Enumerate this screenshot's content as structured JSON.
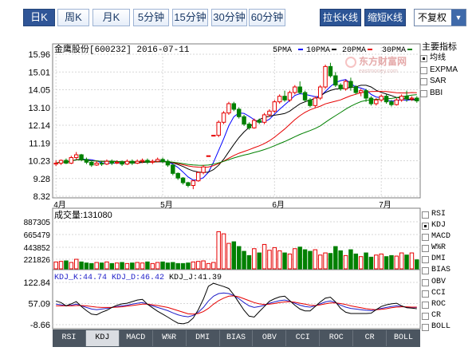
{
  "period_tabs": [
    {
      "label": "日K",
      "active": true
    },
    {
      "label": "周K",
      "active": false
    },
    {
      "label": "月K",
      "active": false
    },
    {
      "label": "5分钟",
      "active": false
    },
    {
      "label": "15分钟",
      "active": false
    },
    {
      "label": "30分钟",
      "active": false
    },
    {
      "label": "60分钟",
      "active": false
    }
  ],
  "controls": {
    "stretch": "拉长K线",
    "shrink": "缩短K线",
    "adjust": "不复权"
  },
  "main": {
    "title": "金鹰股份[600232] 2016-07-11",
    "ma_legend": [
      {
        "label": "5PMA",
        "color": "#0000ff"
      },
      {
        "label": "10PMA",
        "color": "#000000"
      },
      {
        "label": "20PMA",
        "color": "#e60000"
      },
      {
        "label": "30PMA",
        "color": "#008000"
      }
    ],
    "watermark": "东方财富网",
    "watermark_sub": "eastmoney.com"
  },
  "indicators": {
    "title": "主要指标",
    "items": [
      {
        "label": "均线",
        "checked": true
      },
      {
        "label": "EXPMA",
        "checked": false
      },
      {
        "label": "SAR",
        "checked": false
      },
      {
        "label": "BBI",
        "checked": false
      }
    ]
  },
  "volume": {
    "label": "成交量:131080"
  },
  "kdj": {
    "k": "KDJ_K:44.74",
    "d": "KDJ_D:46.42",
    "j": "KDJ_J:41.39"
  },
  "sub_indicators": [
    {
      "label": "RSI",
      "checked": false
    },
    {
      "label": "KDJ",
      "checked": true
    },
    {
      "label": "MACD",
      "checked": false
    },
    {
      "label": "W%R",
      "checked": false
    },
    {
      "label": "DMI",
      "checked": false
    },
    {
      "label": "BIAS",
      "checked": false
    },
    {
      "label": "OBV",
      "checked": false
    },
    {
      "label": "CCI",
      "checked": false
    },
    {
      "label": "ROC",
      "checked": false
    },
    {
      "label": "CR",
      "checked": false
    },
    {
      "label": "BOLL",
      "checked": false
    }
  ],
  "bottom_tabs": [
    {
      "label": "RSI",
      "active": false
    },
    {
      "label": "KDJ",
      "active": true
    },
    {
      "label": "MACD",
      "active": false
    },
    {
      "label": "W%R",
      "active": false
    },
    {
      "label": "DMI",
      "active": false
    },
    {
      "label": "BIAS",
      "active": false
    },
    {
      "label": "OBV",
      "active": false
    },
    {
      "label": "CCI",
      "active": false
    },
    {
      "label": "ROC",
      "active": false
    },
    {
      "label": "CR",
      "active": false
    },
    {
      "label": "BOLL",
      "active": false
    }
  ],
  "chart_data": [
    {
      "type": "candlestick",
      "title": "金鹰股份[600232] 2016-07-11",
      "y_ticks": [
        "15.96",
        "15.01",
        "14.05",
        "13.10",
        "12.14",
        "11.19",
        "10.23",
        "9.28",
        "8.32"
      ],
      "ylim": [
        8.32,
        15.96
      ],
      "x_ticks": [
        "4月",
        "5月",
        "6月",
        "7月"
      ],
      "candles": [
        [
          10.05,
          10.1,
          9.95,
          10.25
        ],
        [
          10.1,
          10.25,
          10.0,
          10.3
        ],
        [
          10.25,
          10.1,
          10.05,
          10.35
        ],
        [
          10.1,
          10.4,
          10.05,
          10.5
        ],
        [
          10.4,
          10.55,
          10.3,
          10.7
        ],
        [
          10.55,
          10.3,
          10.2,
          10.6
        ],
        [
          10.3,
          10.15,
          10.05,
          10.4
        ],
        [
          10.15,
          10.0,
          9.9,
          10.25
        ],
        [
          10.0,
          10.1,
          9.95,
          10.2
        ],
        [
          10.1,
          10.05,
          9.95,
          10.2
        ],
        [
          10.05,
          10.2,
          10.0,
          10.3
        ],
        [
          10.2,
          10.1,
          10.0,
          10.3
        ],
        [
          10.1,
          10.15,
          10.05,
          10.25
        ],
        [
          10.15,
          10.05,
          9.95,
          10.25
        ],
        [
          10.05,
          10.2,
          10.0,
          10.3
        ],
        [
          10.2,
          10.1,
          10.0,
          10.3
        ],
        [
          10.1,
          10.2,
          10.05,
          10.3
        ],
        [
          10.2,
          10.25,
          10.1,
          10.35
        ],
        [
          10.25,
          10.15,
          10.05,
          10.35
        ],
        [
          10.15,
          10.2,
          10.05,
          10.3
        ],
        [
          10.2,
          10.3,
          10.15,
          10.4
        ],
        [
          10.3,
          10.2,
          10.1,
          10.4
        ],
        [
          10.2,
          10.0,
          9.9,
          10.3
        ],
        [
          10.0,
          9.55,
          9.45,
          10.05
        ],
        [
          9.55,
          9.3,
          9.2,
          9.6
        ],
        [
          9.3,
          9.05,
          8.95,
          9.35
        ],
        [
          9.05,
          8.9,
          8.8,
          9.1
        ],
        [
          8.9,
          9.15,
          8.7,
          9.2
        ],
        [
          9.15,
          9.6,
          9.1,
          9.65
        ],
        [
          9.6,
          9.9,
          9.5,
          10.0
        ],
        [
          10.5,
          10.5,
          10.5,
          10.5
        ],
        [
          11.6,
          11.6,
          11.6,
          11.6
        ],
        [
          11.6,
          12.3,
          11.5,
          12.4
        ],
        [
          12.3,
          12.8,
          12.2,
          12.9
        ],
        [
          12.8,
          13.3,
          12.7,
          13.4
        ],
        [
          13.3,
          13.0,
          12.9,
          13.4
        ],
        [
          13.0,
          12.6,
          12.5,
          13.1
        ],
        [
          12.6,
          12.2,
          12.1,
          12.7
        ],
        [
          12.2,
          12.0,
          11.9,
          12.3
        ],
        [
          12.0,
          12.4,
          11.95,
          12.5
        ],
        [
          12.4,
          12.3,
          12.2,
          12.5
        ],
        [
          12.3,
          12.7,
          12.2,
          12.8
        ],
        [
          12.7,
          12.9,
          12.6,
          13.0
        ],
        [
          12.9,
          13.4,
          12.8,
          13.5
        ],
        [
          13.4,
          13.7,
          13.3,
          13.8
        ],
        [
          13.7,
          13.5,
          13.4,
          14.0
        ],
        [
          13.5,
          13.9,
          13.4,
          14.0
        ],
        [
          13.9,
          14.2,
          13.8,
          14.3
        ],
        [
          14.2,
          13.9,
          13.8,
          14.5
        ],
        [
          13.9,
          13.5,
          13.4,
          14.0
        ],
        [
          13.5,
          13.2,
          13.1,
          13.6
        ],
        [
          13.2,
          13.6,
          13.1,
          13.7
        ],
        [
          13.6,
          14.2,
          13.5,
          14.3
        ],
        [
          14.2,
          15.3,
          14.1,
          15.4
        ],
        [
          15.3,
          14.8,
          14.7,
          15.5
        ],
        [
          14.8,
          14.3,
          14.2,
          15.0
        ],
        [
          14.3,
          14.1,
          14.0,
          14.4
        ],
        [
          14.1,
          14.5,
          14.0,
          14.6
        ],
        [
          14.5,
          14.2,
          14.0,
          14.7
        ],
        [
          14.2,
          13.9,
          13.8,
          14.3
        ],
        [
          13.9,
          14.0,
          13.7,
          14.1
        ],
        [
          14.0,
          13.6,
          13.4,
          14.1
        ],
        [
          13.6,
          13.3,
          13.2,
          13.7
        ],
        [
          13.3,
          13.5,
          13.2,
          13.6
        ],
        [
          13.5,
          13.7,
          13.4,
          13.8
        ],
        [
          13.7,
          13.4,
          13.3,
          13.8
        ],
        [
          13.4,
          13.25,
          13.15,
          13.5
        ],
        [
          13.25,
          13.5,
          13.2,
          13.6
        ],
        [
          13.5,
          13.7,
          13.4,
          13.8
        ],
        [
          13.7,
          13.55,
          13.4,
          14.0
        ],
        [
          13.55,
          13.6,
          13.45,
          13.7
        ],
        [
          13.6,
          13.45,
          13.35,
          13.7
        ]
      ]
    },
    {
      "type": "bar",
      "title": "成交量:131080",
      "y_ticks": [
        "887305",
        "665479",
        "443852",
        "221826"
      ],
      "ylim": [
        0,
        887305
      ],
      "values": [
        130000,
        140000,
        150000,
        120000,
        180000,
        130000,
        110000,
        100000,
        120000,
        110000,
        130000,
        100000,
        110000,
        120000,
        100000,
        110000,
        120000,
        110000,
        130000,
        100000,
        120000,
        130000,
        110000,
        120000,
        100000,
        100000,
        110000,
        130000,
        140000,
        150000,
        100000,
        120000,
        700000,
        660000,
        480000,
        510000,
        420000,
        330000,
        250000,
        380000,
        300000,
        460000,
        350000,
        400000,
        340000,
        300000,
        280000,
        380000,
        410000,
        360000,
        330000,
        360000,
        260000,
        300000,
        290000,
        420000,
        340000,
        250000,
        360000,
        280000,
        230000,
        300000,
        220000,
        260000,
        280000,
        230000,
        250000,
        240000,
        300000,
        260000,
        300000,
        170000
      ]
    },
    {
      "type": "line",
      "title": "KDJ",
      "y_ticks": [
        "122.84",
        "57.09",
        "-8.66"
      ],
      "ylim": [
        -8.66,
        122.84
      ],
      "series": [
        {
          "name": "KDJ_K",
          "color": "#1e1ec8",
          "values": [
            55,
            53,
            50,
            52,
            55,
            50,
            45,
            40,
            38,
            40,
            42,
            45,
            48,
            50,
            52,
            55,
            58,
            60,
            55,
            50,
            45,
            40,
            35,
            28,
            22,
            18,
            16,
            20,
            30,
            45,
            65,
            80,
            88,
            90,
            88,
            82,
            72,
            60,
            50,
            45,
            48,
            52,
            58,
            62,
            66,
            68,
            64,
            58,
            52,
            48,
            46,
            50,
            56,
            62,
            65,
            60,
            52,
            46,
            42,
            40,
            38,
            36,
            35,
            38,
            42,
            45,
            48,
            50,
            48,
            46,
            45,
            45
          ]
        },
        {
          "name": "KDJ_D",
          "color": "#e60000",
          "values": [
            50,
            50,
            50,
            50,
            51,
            51,
            50,
            48,
            46,
            45,
            45,
            45,
            46,
            47,
            49,
            51,
            53,
            55,
            55,
            53,
            51,
            48,
            45,
            40,
            35,
            30,
            25,
            24,
            26,
            32,
            42,
            55,
            66,
            74,
            80,
            81,
            78,
            72,
            66,
            60,
            56,
            54,
            55,
            57,
            60,
            62,
            63,
            61,
            58,
            55,
            52,
            51,
            53,
            56,
            59,
            59,
            57,
            54,
            50,
            47,
            44,
            41,
            39,
            38,
            39,
            41,
            44,
            46,
            47,
            47,
            46,
            46
          ]
        },
        {
          "name": "KDJ_J",
          "color": "#000000",
          "values": [
            65,
            60,
            50,
            56,
            63,
            48,
            35,
            24,
            22,
            30,
            36,
            45,
            52,
            56,
            58,
            63,
            68,
            70,
            55,
            44,
            33,
            24,
            15,
            5,
            -4,
            -6,
            -2,
            12,
            38,
            71,
            111,
            120,
            115,
            110,
            104,
            84,
            60,
            36,
            18,
            15,
            32,
            48,
            64,
            72,
            78,
            80,
            66,
            52,
            40,
            34,
            34,
            48,
            62,
            74,
            77,
            62,
            42,
            30,
            26,
            26,
            26,
            26,
            27,
            38,
            48,
            53,
            56,
            58,
            50,
            44,
            43,
            41
          ]
        }
      ]
    }
  ]
}
